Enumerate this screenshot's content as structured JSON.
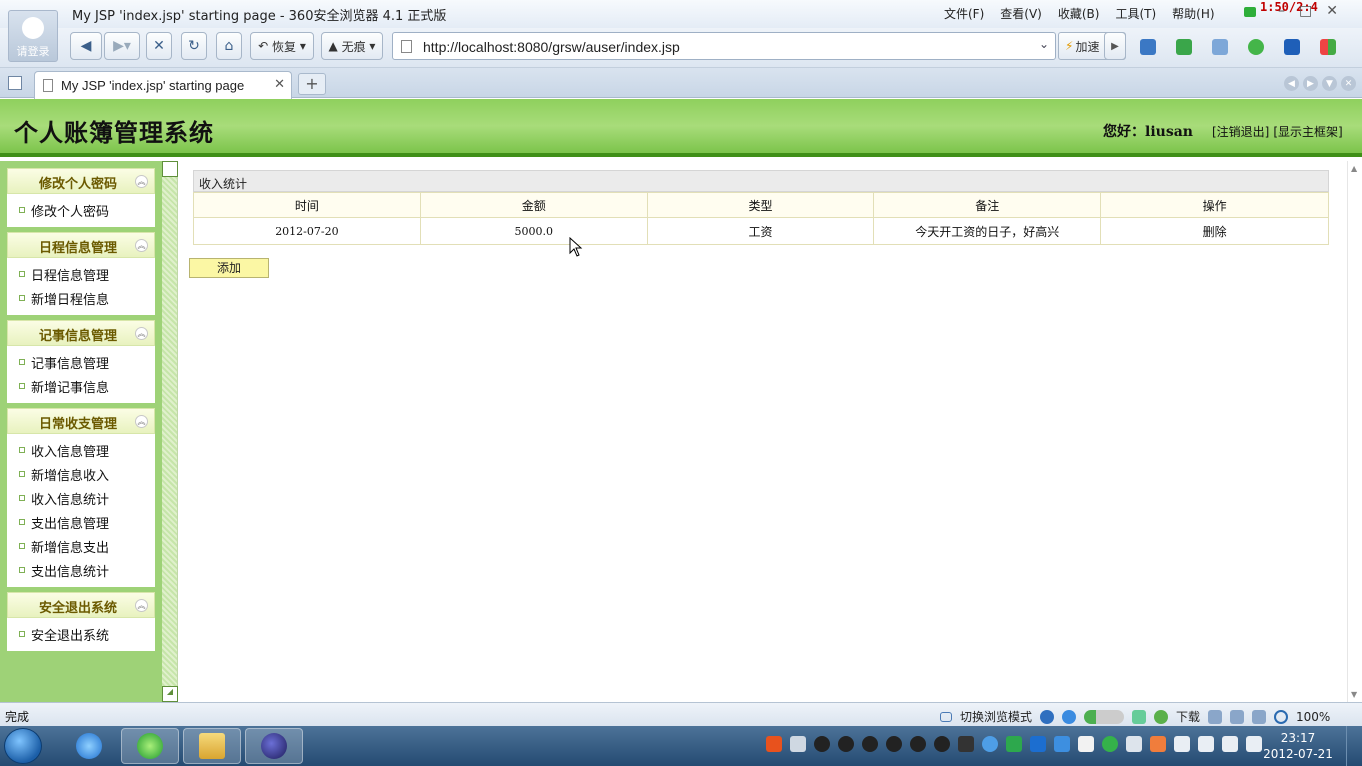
{
  "browser": {
    "avatar_label": "请登录",
    "window_title": "My JSP 'index.jsp' starting page - 360安全浏览器 4.1 正式版",
    "menus": [
      "文件(F)",
      "查看(V)",
      "收藏(B)",
      "工具(T)",
      "帮助(H)"
    ],
    "overlay_time": "1:50/2:4",
    "toolbar": {
      "restore_label": "恢复",
      "incognito_label": "无痕",
      "url": "http://localhost:8080/grsw/auser/index.jsp",
      "accelerate_label": "加速"
    },
    "tab": {
      "label": "My JSP 'index.jsp' starting page"
    }
  },
  "header": {
    "title": "个人账簿管理系统",
    "greeting": "您好：liusan",
    "logout_link": "[注销退出]",
    "frame_link": "[显示主框架]"
  },
  "sidebar": {
    "groups": [
      {
        "title": "修改个人密码",
        "items": [
          "修改个人密码"
        ]
      },
      {
        "title": "日程信息管理",
        "items": [
          "日程信息管理",
          "新增日程信息"
        ]
      },
      {
        "title": "记事信息管理",
        "items": [
          "记事信息管理",
          "新增记事信息"
        ]
      },
      {
        "title": "日常收支管理",
        "items": [
          "收入信息管理",
          "新增信息收入",
          "收入信息统计",
          "支出信息管理",
          "新增信息支出",
          "支出信息统计"
        ]
      },
      {
        "title": "安全退出系统",
        "items": [
          "安全退出系统"
        ]
      }
    ]
  },
  "main": {
    "panel_title": "收入统计",
    "columns": [
      "时间",
      "金额",
      "类型",
      "备注",
      "操作"
    ],
    "rows": [
      {
        "time": "2012-07-20",
        "amount": "5000.0",
        "type": "工资",
        "note": "今天开工资的日子，好高兴",
        "action": "删除"
      }
    ],
    "add_label": "添加"
  },
  "statusbar": {
    "status": "完成",
    "mode_switch": "切换浏览模式",
    "download": "下载",
    "zoom": "100%"
  },
  "taskbar": {
    "time": "23:17",
    "date": "2012-07-21"
  },
  "colors": {
    "header_green": "#8fd05d",
    "header_border": "#3f8f17",
    "menu_title": "#6b5a00",
    "add_button": "#fbf7a4"
  }
}
